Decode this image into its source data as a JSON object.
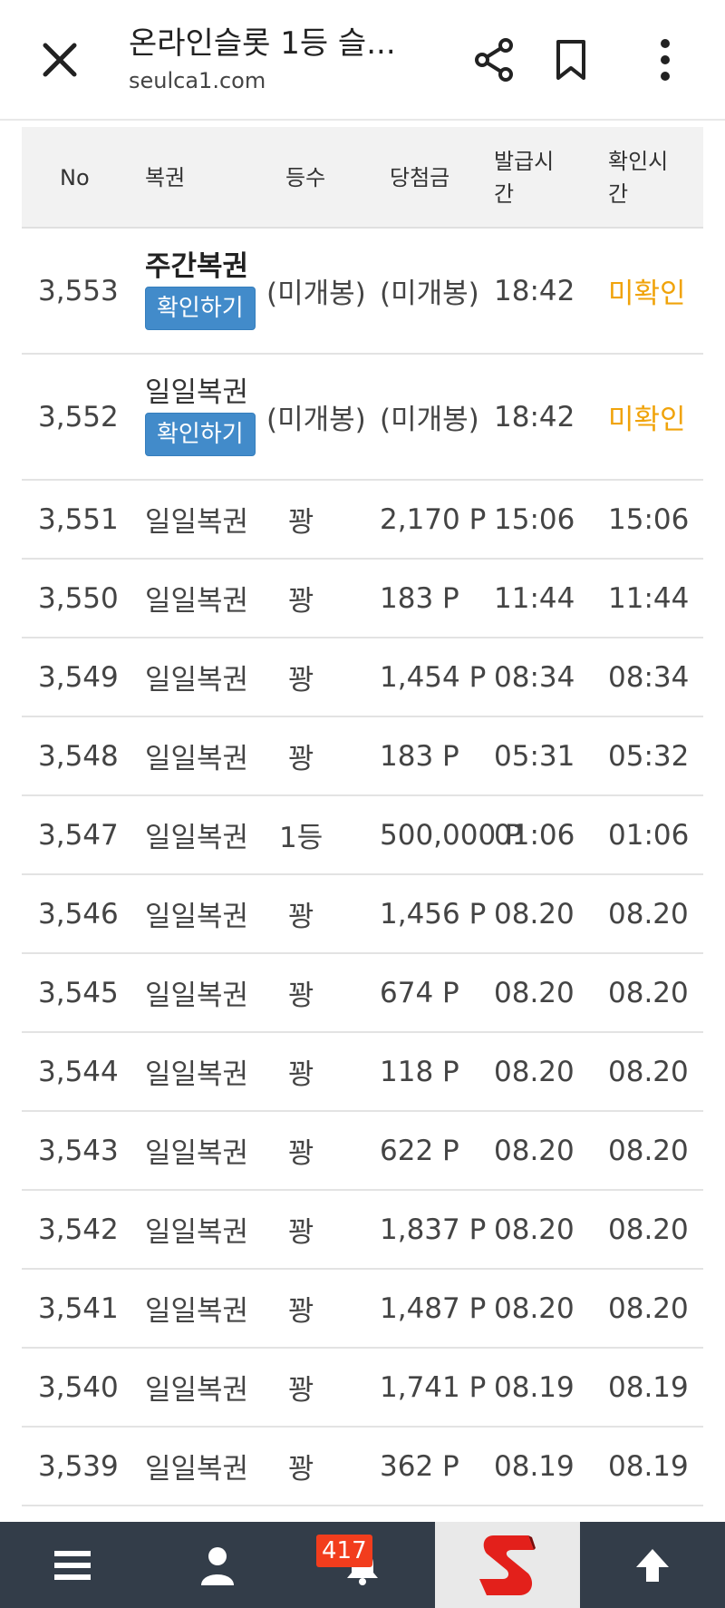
{
  "browser": {
    "title": "온라인슬롯 1등 슬...",
    "url": "seulca1.com"
  },
  "table": {
    "headers": {
      "no": "No",
      "type": "복권",
      "grade": "등수",
      "prize": "당첨금",
      "issued_line1": "발급시",
      "issued_line2": "간",
      "checked_line1": "확인시",
      "checked_line2": "간"
    },
    "confirm_label": "확인하기",
    "pending_rows": [
      {
        "no": "3,553",
        "type": "주간복권",
        "grade": "(미개봉)",
        "prize": "(미개봉)",
        "issued": "18:42",
        "checked": "미확인"
      },
      {
        "no": "3,552",
        "type": "일일복권",
        "grade": "(미개봉)",
        "prize": "(미개봉)",
        "issued": "18:42",
        "checked": "미확인"
      }
    ],
    "rows": [
      {
        "no": "3,551",
        "type": "일일복권",
        "grade": "꽝",
        "prize": "2,170 P",
        "issued": "15:06",
        "checked": "15:06"
      },
      {
        "no": "3,550",
        "type": "일일복권",
        "grade": "꽝",
        "prize": "183 P",
        "issued": "11:44",
        "checked": "11:44"
      },
      {
        "no": "3,549",
        "type": "일일복권",
        "grade": "꽝",
        "prize": "1,454 P",
        "issued": "08:34",
        "checked": "08:34"
      },
      {
        "no": "3,548",
        "type": "일일복권",
        "grade": "꽝",
        "prize": "183 P",
        "issued": "05:31",
        "checked": "05:32"
      },
      {
        "no": "3,547",
        "type": "일일복권",
        "grade": "1등",
        "prize": "500,000 P",
        "issued": "01:06",
        "checked": "01:06"
      },
      {
        "no": "3,546",
        "type": "일일복권",
        "grade": "꽝",
        "prize": "1,456 P",
        "issued": "08.20",
        "checked": "08.20"
      },
      {
        "no": "3,545",
        "type": "일일복권",
        "grade": "꽝",
        "prize": "674 P",
        "issued": "08.20",
        "checked": "08.20"
      },
      {
        "no": "3,544",
        "type": "일일복권",
        "grade": "꽝",
        "prize": "118 P",
        "issued": "08.20",
        "checked": "08.20"
      },
      {
        "no": "3,543",
        "type": "일일복권",
        "grade": "꽝",
        "prize": "622 P",
        "issued": "08.20",
        "checked": "08.20"
      },
      {
        "no": "3,542",
        "type": "일일복권",
        "grade": "꽝",
        "prize": "1,837 P",
        "issued": "08.20",
        "checked": "08.20"
      },
      {
        "no": "3,541",
        "type": "일일복권",
        "grade": "꽝",
        "prize": "1,487 P",
        "issued": "08.20",
        "checked": "08.20"
      },
      {
        "no": "3,540",
        "type": "일일복권",
        "grade": "꽝",
        "prize": "1,741 P",
        "issued": "08.19",
        "checked": "08.19"
      },
      {
        "no": "3,539",
        "type": "일일복권",
        "grade": "꽝",
        "prize": "362 P",
        "issued": "08.19",
        "checked": "08.19"
      }
    ]
  },
  "bottom_nav": {
    "notification_count": "417",
    "icons": [
      "menu-icon",
      "user-icon",
      "bell-icon",
      "site-logo",
      "arrow-up-icon"
    ]
  },
  "colors": {
    "confirm_button": "#428bca",
    "unconfirmed_text": "#f0a30a",
    "nav_background": "#333d49",
    "badge": "#f23d1d",
    "logo_red": "#e3201b"
  }
}
